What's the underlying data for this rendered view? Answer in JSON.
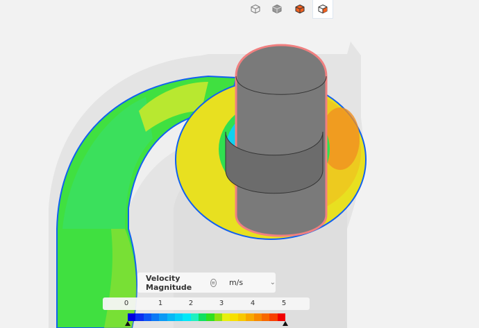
{
  "toolbar": {
    "buttons": [
      {
        "name": "view-wireframe-button",
        "icon": "wireframe-cube-icon"
      },
      {
        "name": "view-solid-button",
        "icon": "solid-cube-icon"
      },
      {
        "name": "view-orange-solid-button",
        "icon": "orange-cube-icon"
      },
      {
        "name": "view-orange-outline-button",
        "icon": "orange-outline-cube-icon",
        "active": true
      }
    ]
  },
  "legend": {
    "title": "Velocity Magnitude",
    "unit": "m/s",
    "ticks": [
      "0",
      "1",
      "2",
      "3",
      "4",
      "5"
    ],
    "min": 0,
    "max": 5,
    "colors": [
      "#0000e0",
      "#0a2ff0",
      "#0a55f5",
      "#0a78f5",
      "#0a9af5",
      "#08b8f5",
      "#05d0f8",
      "#00e8f8",
      "#20f0c0",
      "#10e060",
      "#30e020",
      "#90e010",
      "#e8f010",
      "#f8e000",
      "#f8c800",
      "#f8a800",
      "#f88800",
      "#f86800",
      "#f84000",
      "#f00000"
    ]
  }
}
